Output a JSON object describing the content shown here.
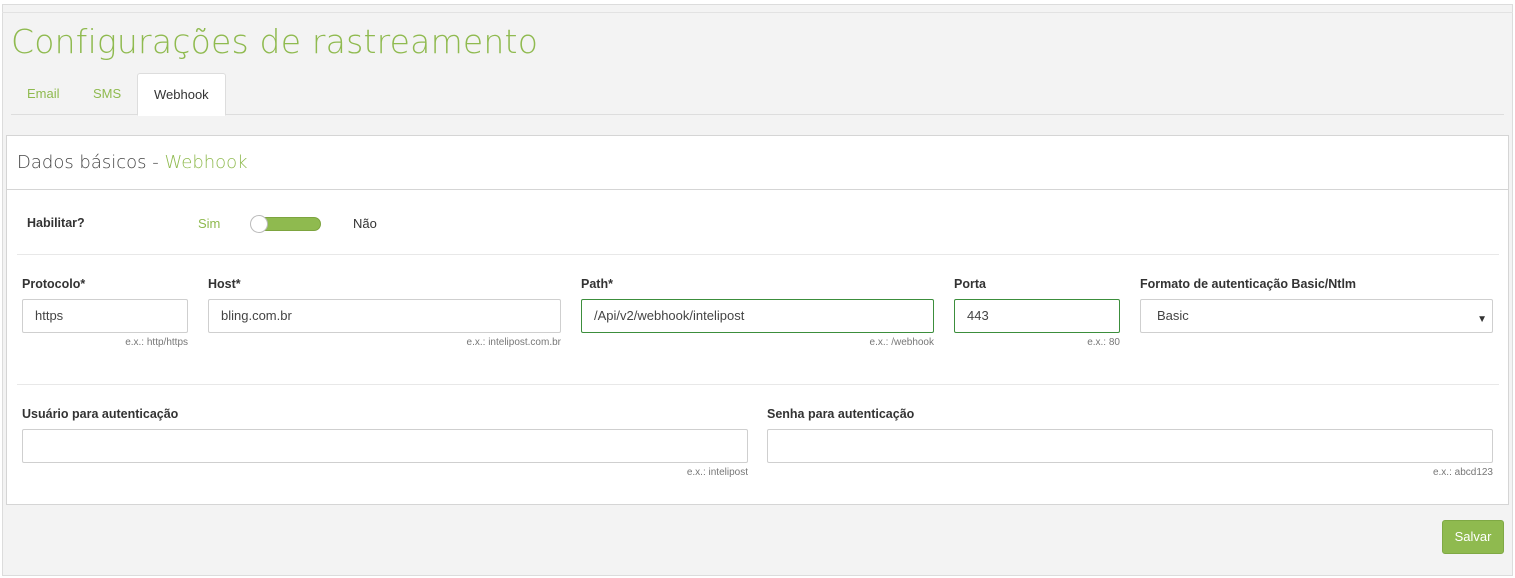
{
  "page": {
    "title": "Configurações de rastreamento"
  },
  "tabs": [
    {
      "label": "Email",
      "active": false
    },
    {
      "label": "SMS",
      "active": false
    },
    {
      "label": "Webhook",
      "active": true
    }
  ],
  "panel": {
    "title_prefix": "Dados básicos - ",
    "title_accent": "Webhook"
  },
  "enable": {
    "label": "Habilitar?",
    "yes_label": "Sim",
    "no_label": "Não",
    "state": "Sim"
  },
  "fields": {
    "protocol": {
      "label": "Protocolo*",
      "value": "https",
      "hint": "e.x.: http/https"
    },
    "host": {
      "label": "Host*",
      "value": "bling.com.br",
      "hint": "e.x.: intelipost.com.br"
    },
    "path": {
      "label": "Path*",
      "value": "/Api/v2/webhook/intelipost",
      "hint": "e.x.: /webhook"
    },
    "port": {
      "label": "Porta",
      "value": "443",
      "hint": "e.x.: 80"
    },
    "auth_format": {
      "label": "Formato de autenticação Basic/Ntlm",
      "value": "Basic"
    },
    "auth_user": {
      "label": "Usuário para autenticação",
      "value": "",
      "hint": "e.x.: intelipost"
    },
    "auth_password": {
      "label": "Senha para autenticação",
      "value": "",
      "hint": "e.x.: abcd123"
    }
  },
  "actions": {
    "save_label": "Salvar"
  },
  "colors": {
    "accent": "#8fba4f",
    "focus_border": "#3c8e3c"
  },
  "icons": {
    "select_arrow": "chevron-down-icon"
  }
}
